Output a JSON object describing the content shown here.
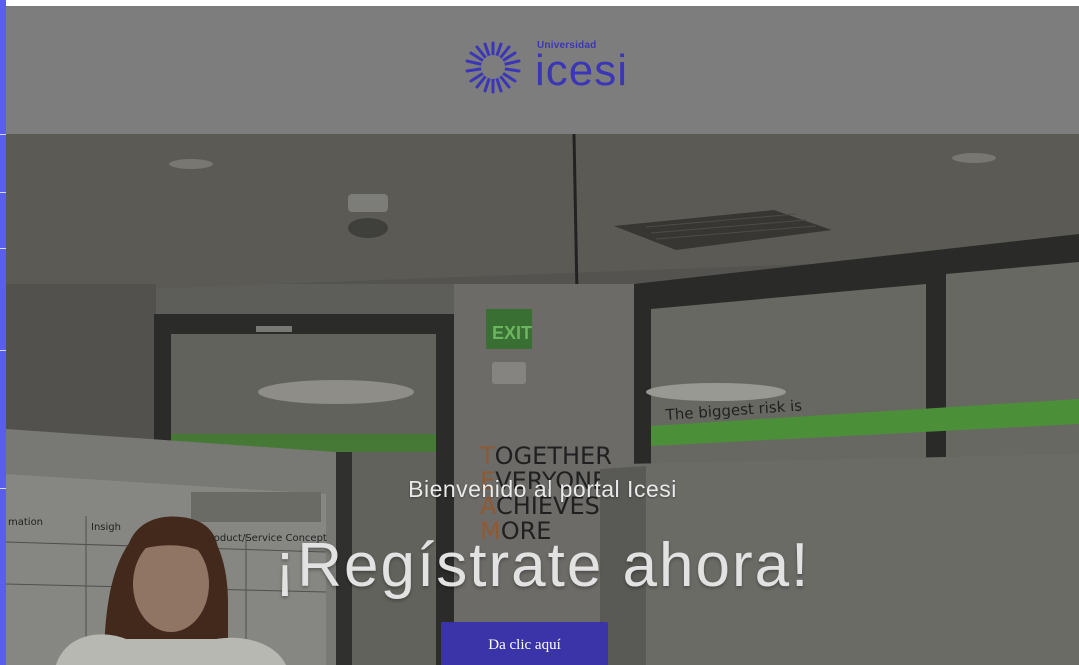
{
  "header": {
    "logo": {
      "small_text": "Universidad",
      "big_text": "icesi"
    }
  },
  "hero": {
    "subtitle": "Bienvenido al portal Icesi",
    "title": "¡Regístrate ahora!",
    "cta_label": "Da clic aquí",
    "background_signage": {
      "sign_letters": [
        "T",
        "E",
        "A",
        "M"
      ],
      "sign_words": [
        "OGETHER",
        "VERYONE",
        "CHIEVES",
        "ORE"
      ],
      "board_labels": [
        "mation",
        "Insigh",
        "Product/Service Concept"
      ],
      "wall_text": "The biggest risk is"
    }
  },
  "colors": {
    "accent": "#3a34a8",
    "header_bg": "#7d7d7d",
    "left_strip": "#5b5cf0"
  }
}
